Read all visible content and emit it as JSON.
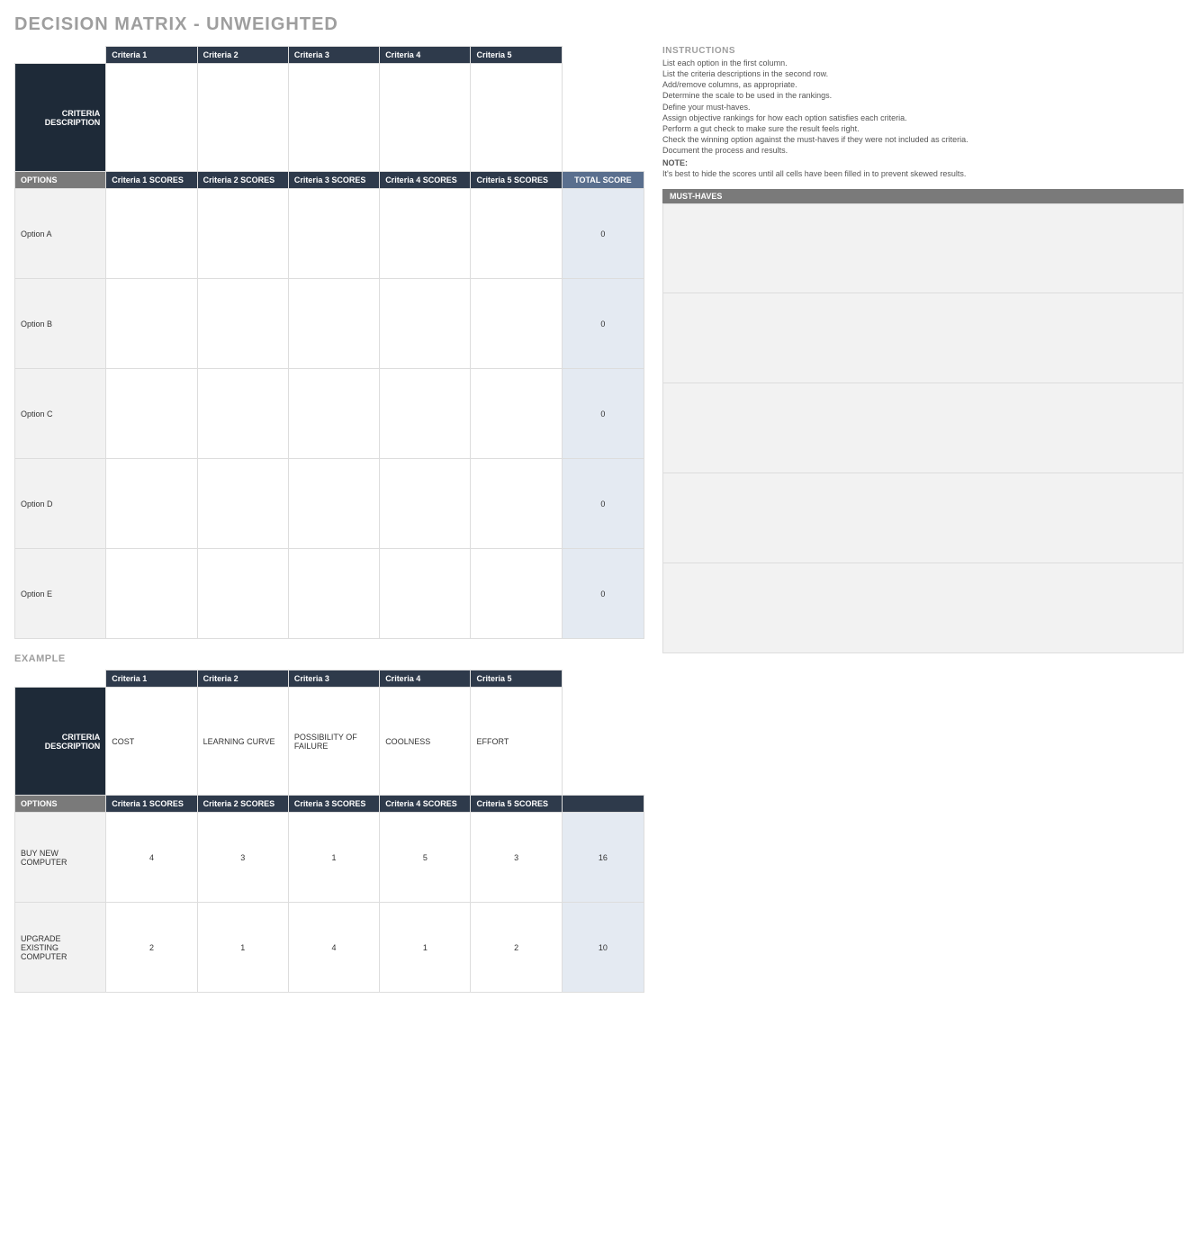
{
  "title": "DECISION MATRIX - UNWEIGHTED",
  "labels": {
    "criteria_description": "CRITERIA DESCRIPTION",
    "options": "OPTIONS",
    "total_score": "TOTAL SCORE",
    "must_haves": "MUST-HAVES",
    "example": "EXAMPLE"
  },
  "main": {
    "criteria_headers": [
      "Criteria 1",
      "Criteria 2",
      "Criteria 3",
      "Criteria 4",
      "Criteria 5"
    ],
    "criteria_descriptions": [
      "",
      "",
      "",
      "",
      ""
    ],
    "score_headers": [
      "Criteria 1 SCORES",
      "Criteria 2 SCORES",
      "Criteria 3 SCORES",
      "Criteria 4 SCORES",
      "Criteria 5 SCORES"
    ],
    "options": [
      {
        "name": "Option A",
        "scores": [
          "",
          "",
          "",
          "",
          ""
        ],
        "total": "0"
      },
      {
        "name": "Option B",
        "scores": [
          "",
          "",
          "",
          "",
          ""
        ],
        "total": "0"
      },
      {
        "name": "Option C",
        "scores": [
          "",
          "",
          "",
          "",
          ""
        ],
        "total": "0"
      },
      {
        "name": "Option D",
        "scores": [
          "",
          "",
          "",
          "",
          ""
        ],
        "total": "0"
      },
      {
        "name": "Option E",
        "scores": [
          "",
          "",
          "",
          "",
          ""
        ],
        "total": "0"
      }
    ],
    "must_haves": [
      "",
      "",
      "",
      "",
      ""
    ]
  },
  "instructions": {
    "title": "INSTRUCTIONS",
    "lines": [
      "List each option in the first column.",
      "List the criteria descriptions in the second row.",
      "Add/remove columns, as appropriate.",
      "Determine the scale to be used in the rankings.",
      "Define your must-haves.",
      "Assign objective rankings for how each option satisfies each criteria.",
      "Perform a gut check to make sure the result feels right.",
      "Check the winning option against the must-haves if they were not included as criteria.",
      "Document the process and results."
    ],
    "note_label": "NOTE:",
    "note_text": "It's best to hide the scores until all cells have been filled in to prevent skewed results."
  },
  "example": {
    "criteria_headers": [
      "Criteria 1",
      "Criteria 2",
      "Criteria 3",
      "Criteria 4",
      "Criteria 5"
    ],
    "criteria_descriptions": [
      "COST",
      "LEARNING CURVE",
      "POSSIBILITY OF FAILURE",
      "COOLNESS",
      "EFFORT"
    ],
    "score_headers": [
      "Criteria 1 SCORES",
      "Criteria 2 SCORES",
      "Criteria 3 SCORES",
      "Criteria 4 SCORES",
      "Criteria 5 SCORES"
    ],
    "options": [
      {
        "name": "BUY NEW COMPUTER",
        "scores": [
          "4",
          "3",
          "1",
          "5",
          "3"
        ],
        "total": "16"
      },
      {
        "name": "UPGRADE EXISTING COMPUTER",
        "scores": [
          "2",
          "1",
          "4",
          "1",
          "2"
        ],
        "total": "10"
      }
    ]
  }
}
